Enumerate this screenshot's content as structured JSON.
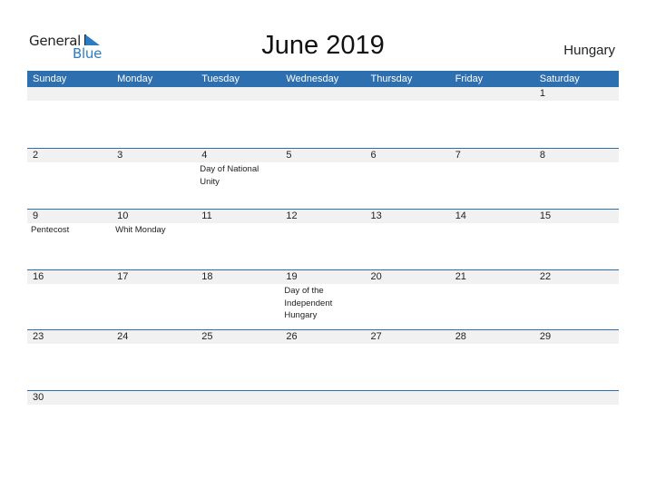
{
  "logo": {
    "general": "General",
    "blue": "Blue"
  },
  "title": "June 2019",
  "country": "Hungary",
  "weekdays": [
    "Sunday",
    "Monday",
    "Tuesday",
    "Wednesday",
    "Thursday",
    "Friday",
    "Saturday"
  ],
  "weeks": [
    [
      {
        "d": ""
      },
      {
        "d": ""
      },
      {
        "d": ""
      },
      {
        "d": ""
      },
      {
        "d": ""
      },
      {
        "d": ""
      },
      {
        "d": "1"
      }
    ],
    [
      {
        "d": "2"
      },
      {
        "d": "3"
      },
      {
        "d": "4",
        "e": "Day of National Unity"
      },
      {
        "d": "5"
      },
      {
        "d": "6"
      },
      {
        "d": "7"
      },
      {
        "d": "8"
      }
    ],
    [
      {
        "d": "9",
        "e": "Pentecost"
      },
      {
        "d": "10",
        "e": "Whit Monday"
      },
      {
        "d": "11"
      },
      {
        "d": "12"
      },
      {
        "d": "13"
      },
      {
        "d": "14"
      },
      {
        "d": "15"
      }
    ],
    [
      {
        "d": "16"
      },
      {
        "d": "17"
      },
      {
        "d": "18"
      },
      {
        "d": "19",
        "e": "Day of the Independent Hungary"
      },
      {
        "d": "20"
      },
      {
        "d": "21"
      },
      {
        "d": "22"
      }
    ],
    [
      {
        "d": "23"
      },
      {
        "d": "24"
      },
      {
        "d": "25"
      },
      {
        "d": "26"
      },
      {
        "d": "27"
      },
      {
        "d": "28"
      },
      {
        "d": "29"
      }
    ],
    [
      {
        "d": "30"
      },
      {
        "d": ""
      },
      {
        "d": ""
      },
      {
        "d": ""
      },
      {
        "d": ""
      },
      {
        "d": ""
      },
      {
        "d": ""
      }
    ]
  ]
}
